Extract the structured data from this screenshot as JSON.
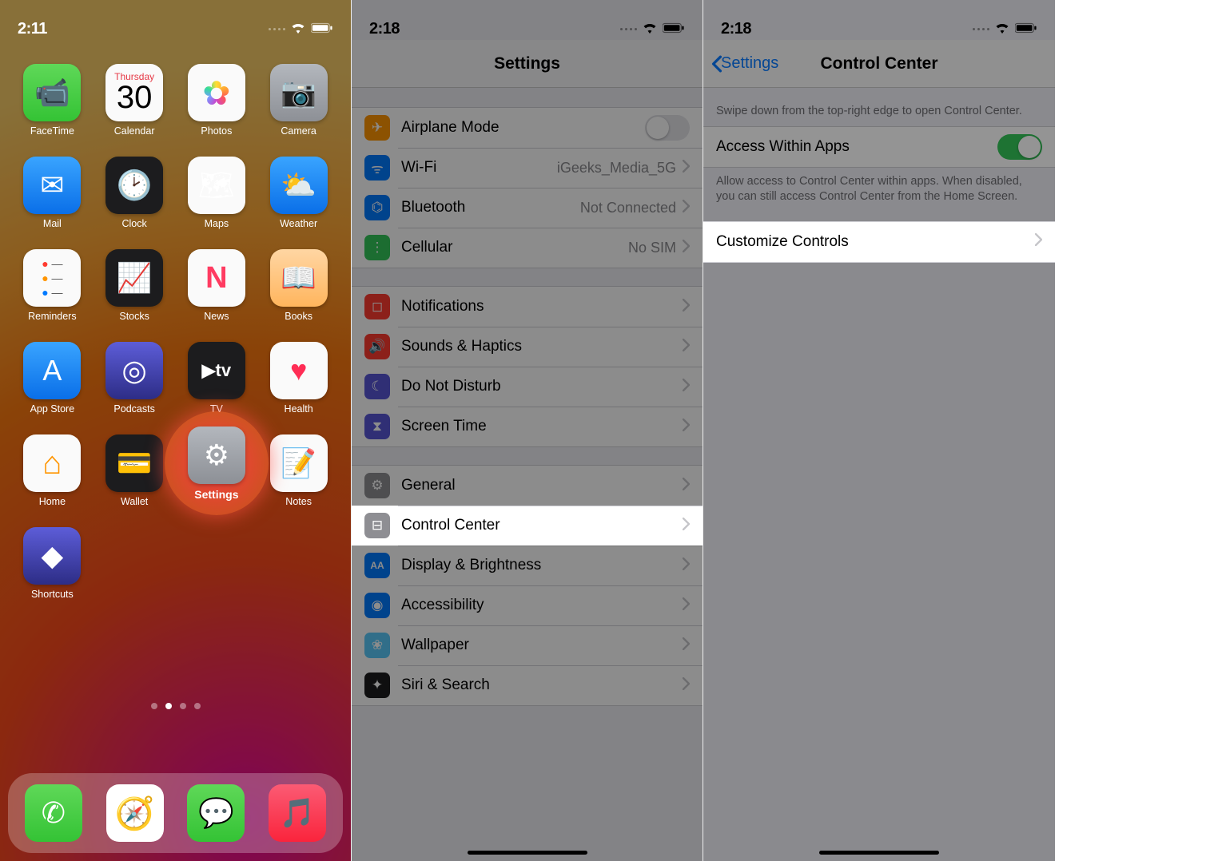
{
  "panel1": {
    "time": "2:11",
    "apps": [
      {
        "label": "FaceTime",
        "color": "green",
        "glyph": "📹"
      },
      {
        "label": "Calendar",
        "color": "white",
        "calendar": {
          "weekday": "Thursday",
          "date": "30"
        }
      },
      {
        "label": "Photos",
        "color": "white",
        "glyph": "✿"
      },
      {
        "label": "Camera",
        "color": "gray",
        "glyph": "📷"
      },
      {
        "label": "Mail",
        "color": "blue",
        "glyph": "✉"
      },
      {
        "label": "Clock",
        "color": "dark",
        "glyph": "🕑"
      },
      {
        "label": "Maps",
        "color": "white",
        "glyph": "🗺"
      },
      {
        "label": "Weather",
        "color": "blue",
        "glyph": "⛅"
      },
      {
        "label": "Reminders",
        "color": "white",
        "glyph": "≡"
      },
      {
        "label": "Stocks",
        "color": "dark",
        "glyph": "📈"
      },
      {
        "label": "News",
        "color": "white",
        "glyph": "N"
      },
      {
        "label": "Books",
        "color": "orangebg",
        "glyph": "📖"
      },
      {
        "label": "App Store",
        "color": "blue",
        "glyph": "A"
      },
      {
        "label": "Podcasts",
        "color": "purple",
        "glyph": "◎"
      },
      {
        "label": "TV",
        "color": "dark",
        "glyph": "tv"
      },
      {
        "label": "Health",
        "color": "white",
        "glyph": "♥"
      },
      {
        "label": "Home",
        "color": "white",
        "glyph": "⌂"
      },
      {
        "label": "Wallet",
        "color": "dark",
        "glyph": "💳"
      },
      {
        "label": "Settings",
        "color": "gray",
        "glyph": "⚙"
      },
      {
        "label": "Notes",
        "color": "white",
        "glyph": "📝"
      },
      {
        "label": "Shortcuts",
        "color": "purple",
        "glyph": "◆"
      }
    ],
    "dock": [
      {
        "name": "Phone",
        "color": "green",
        "glyph": "✆"
      },
      {
        "name": "Safari",
        "color": "blue",
        "glyph": "🧭"
      },
      {
        "name": "Messages",
        "color": "green",
        "glyph": "💬"
      },
      {
        "name": "Music",
        "color": "white",
        "glyph": "🎵"
      }
    ],
    "highlighted_app": "Settings"
  },
  "panel2": {
    "time": "2:18",
    "title": "Settings",
    "groups": [
      [
        {
          "icon": "orange-i",
          "glyph": "✈",
          "label": "Airplane Mode",
          "control": "switch-off"
        },
        {
          "icon": "blue-i",
          "glyph": "ᯤ",
          "label": "Wi-Fi",
          "value": "iGeeks_Media_5G",
          "chevron": true
        },
        {
          "icon": "blue-i",
          "glyph": "⌬",
          "label": "Bluetooth",
          "value": "Not Connected",
          "chevron": true
        },
        {
          "icon": "green-i",
          "glyph": "⋮",
          "label": "Cellular",
          "value": "No SIM",
          "chevron": true
        }
      ],
      [
        {
          "icon": "red-i",
          "glyph": "◻",
          "label": "Notifications",
          "chevron": true
        },
        {
          "icon": "red-i",
          "glyph": "🔊",
          "label": "Sounds & Haptics",
          "chevron": true
        },
        {
          "icon": "purple-i",
          "glyph": "☾",
          "label": "Do Not Disturb",
          "chevron": true
        },
        {
          "icon": "purple-i",
          "glyph": "⧗",
          "label": "Screen Time",
          "chevron": true
        }
      ],
      [
        {
          "icon": "gray-i",
          "glyph": "⚙",
          "label": "General",
          "chevron": true
        },
        {
          "icon": "gray-i",
          "glyph": "⊟",
          "label": "Control Center",
          "chevron": true,
          "highlight": true
        },
        {
          "icon": "blue-i",
          "glyph": "AA",
          "label": "Display & Brightness",
          "chevron": true
        },
        {
          "icon": "blue-i",
          "glyph": "◉",
          "label": "Accessibility",
          "chevron": true
        },
        {
          "icon": "teal-i",
          "glyph": "❀",
          "label": "Wallpaper",
          "chevron": true
        },
        {
          "icon": "dark-i",
          "glyph": "✦",
          "label": "Siri & Search",
          "chevron": true
        }
      ]
    ]
  },
  "panel3": {
    "time": "2:18",
    "back": "Settings",
    "title": "Control Center",
    "header_desc": "Swipe down from the top-right edge to open Control Center.",
    "access_label": "Access Within Apps",
    "access_desc": "Allow access to Control Center within apps. When disabled, you can still access Control Center from the Home Screen.",
    "customize_label": "Customize Controls"
  }
}
